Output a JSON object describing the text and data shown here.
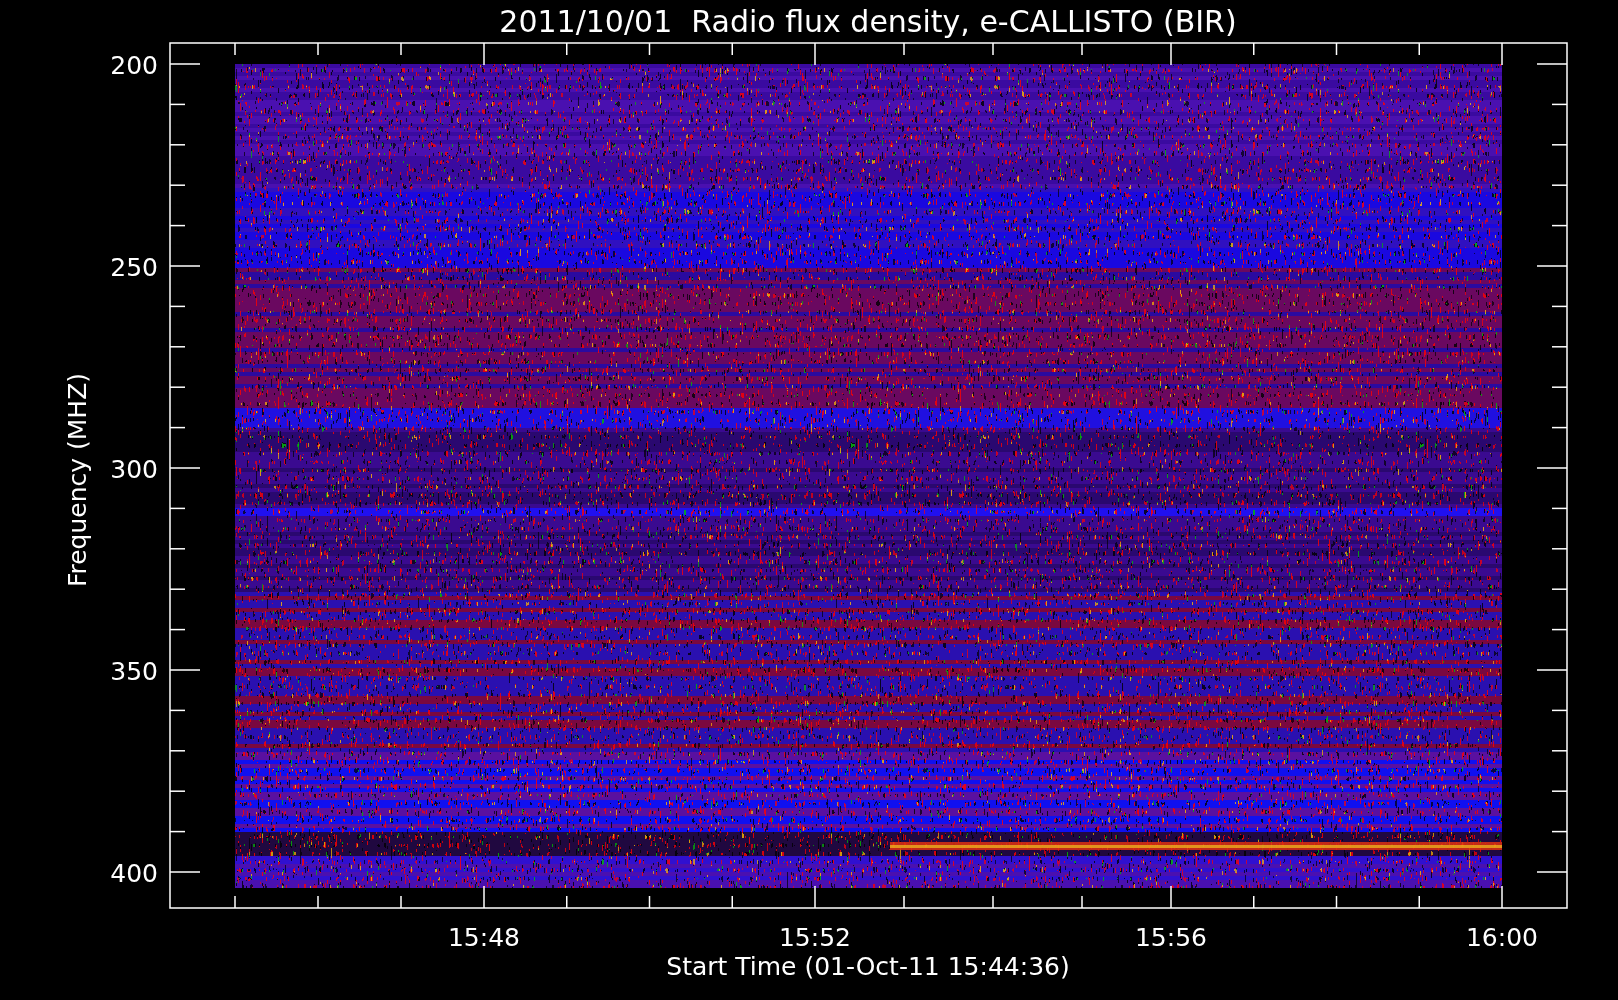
{
  "plot": {
    "title": "2011/10/01  Radio flux density, e-CALLISTO (BIR)",
    "ylabel": "Frequency (MHZ)",
    "xlabel": "Start Time (01-Oct-11 15:44:36)",
    "yticks": [
      "200",
      "250",
      "300",
      "350",
      "400"
    ],
    "xticks": [
      "15:48",
      "15:52",
      "15:56",
      "16:00"
    ]
  }
}
